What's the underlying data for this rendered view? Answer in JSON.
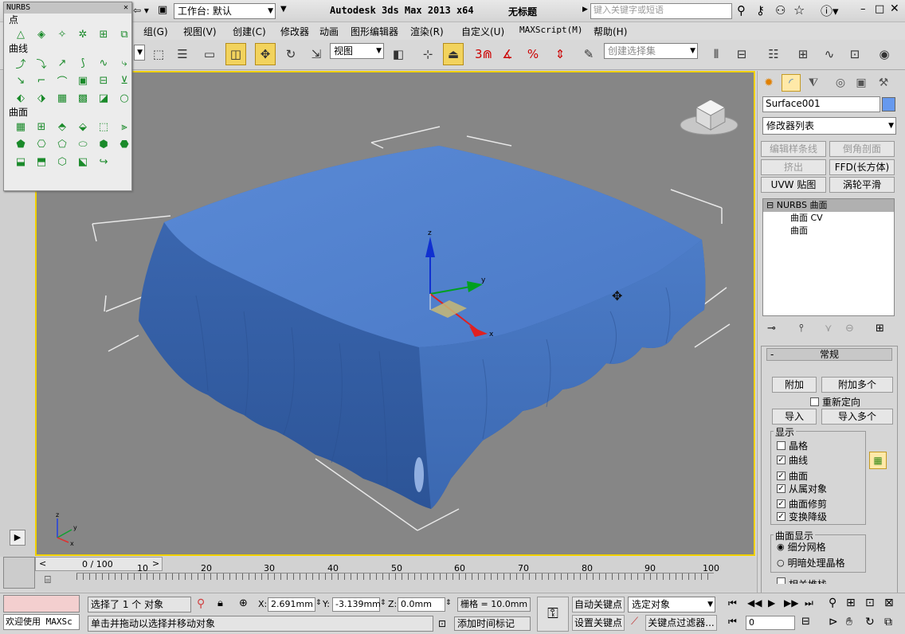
{
  "title": {
    "workspace_label": "工作台: 默认",
    "app": "Autodesk 3ds Max  2013 x64",
    "doc": "无标题",
    "search_placeholder": "键入关键字或短语"
  },
  "menu": [
    "组(G)",
    "视图(V)",
    "创建(C)",
    "修改器",
    "动画",
    "图形编辑器",
    "渲染(R)",
    "自定义(U)",
    "MAXScript(M)",
    "帮助(H)"
  ],
  "toolbar": {
    "view_dropdown": "视图",
    "selection_set": "创建选择集",
    "snap_label": "3"
  },
  "nurbs": {
    "title": "NURBS",
    "sec_point": "点",
    "sec_curve": "曲线",
    "sec_surface": "曲面"
  },
  "viewport": {
    "axis_x": "x",
    "axis_y": "y",
    "axis_z": "z"
  },
  "cmd": {
    "object_name": "Surface001",
    "object_color": "#6699ee",
    "modifier_list": "修改器列表",
    "buttons": [
      "编辑样条线",
      "倒角剖面",
      "挤出",
      "FFD(长方体)",
      "UVW 贴图",
      "涡轮平滑"
    ],
    "stack": [
      "NURBS 曲面",
      "曲面 CV",
      "曲面"
    ],
    "rollout_title": "常规",
    "attach": "附加",
    "attach_multi": "附加多个",
    "reorient": "重新定向",
    "import": "导入",
    "import_multi": "导入多个",
    "display_group": "显示",
    "display": [
      {
        "label": "晶格",
        "checked": false
      },
      {
        "label": "曲线",
        "checked": true
      },
      {
        "label": "曲面",
        "checked": true
      },
      {
        "label": "从属对象",
        "checked": true
      },
      {
        "label": "曲面修剪",
        "checked": true
      },
      {
        "label": "变换降级",
        "checked": true
      }
    ],
    "surface_display_group": "曲面显示",
    "radio": [
      "细分网格",
      "明暗处理晶格"
    ],
    "cut_label": "相关堆栈"
  },
  "timeline": {
    "frame": "0 / 100",
    "ticks": [
      "10",
      "20",
      "30",
      "40",
      "50",
      "60",
      "70",
      "80",
      "90",
      "100"
    ]
  },
  "status": {
    "maxscript": "欢迎使用 MAXSc",
    "selected": "选择了 1 个 对象",
    "prompt": "单击并拖动以选择并移动对象",
    "x_label": "X:",
    "x_value": "2.691mm",
    "y_label": "Y:",
    "y_value": "-3.139mm",
    "z_label": "Z:",
    "z_value": "0.0mm",
    "grid": "栅格 = 10.0mm",
    "add_tag": "添加时间标记",
    "auto_key": "自动关键点",
    "set_key": "设置关键点",
    "sel_obj": "选定对象",
    "key_filter": "关键点过滤器...",
    "frame_field": "0"
  }
}
